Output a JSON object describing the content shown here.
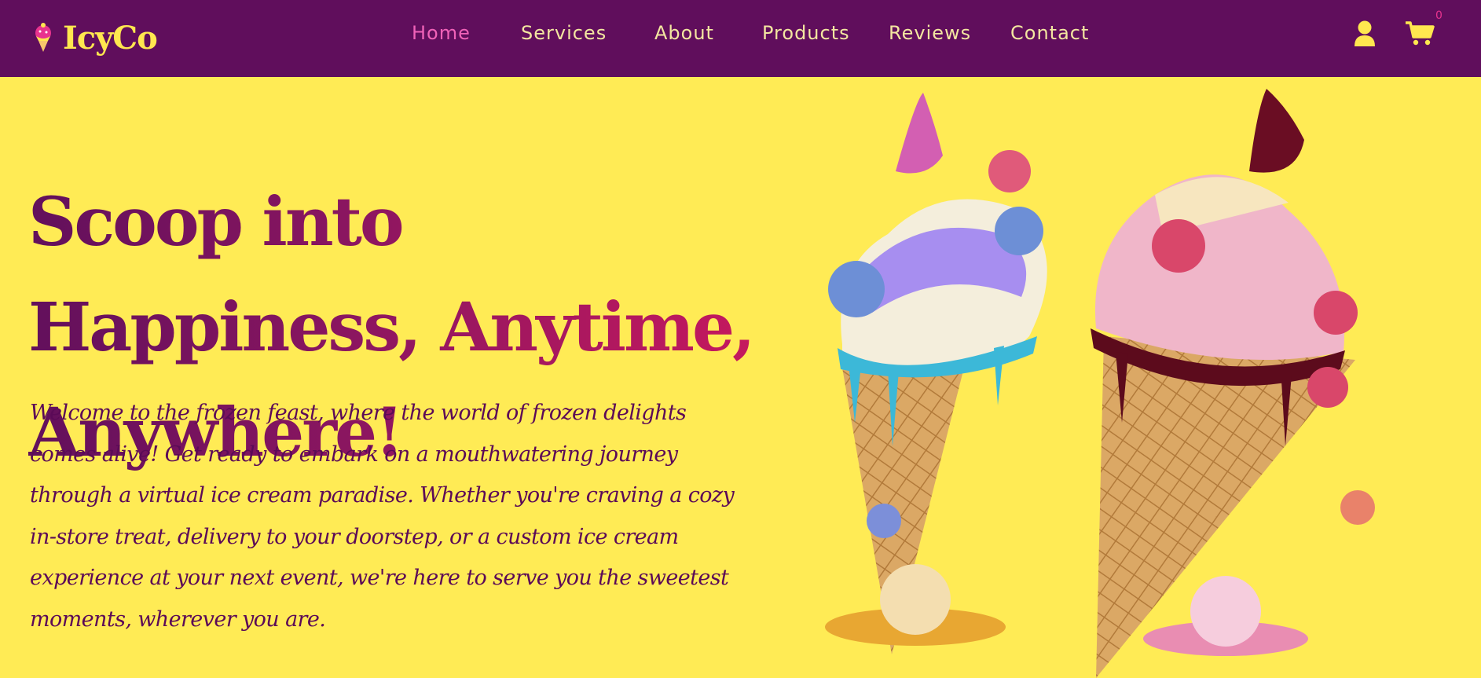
{
  "brand": {
    "name": "IcyCo"
  },
  "nav": {
    "links": [
      {
        "label": "Home",
        "active": true
      },
      {
        "label": "Services",
        "active": false
      },
      {
        "label": "About",
        "active": false
      },
      {
        "label": "Products",
        "active": false
      },
      {
        "label": "Reviews",
        "active": false
      },
      {
        "label": "Contact",
        "active": false
      }
    ]
  },
  "header_icons": {
    "user": "user-icon",
    "cart": "cart-icon",
    "cart_count": "0"
  },
  "hero": {
    "title": "Scoop into Happiness, Anytime, Anywhere!",
    "description": "Welcome to the frozen feast, where the world of frozen delights comes alive! Get ready to embark on a mouthwatering journey through a virtual ice cream paradise. Whether you're craving a cozy in-store treat, delivery to your doorstep, or a custom ice cream experience at your next event, we're here to serve you the sweetest moments, wherever you are.",
    "image": "two-ice-cream-cones"
  },
  "colors": {
    "navbar": "#600e5c",
    "background": "#ffeb55",
    "accent": "#ffe74f",
    "active_link": "#f062b8",
    "title_gradient": [
      "#62105c",
      "#c9195e"
    ]
  }
}
